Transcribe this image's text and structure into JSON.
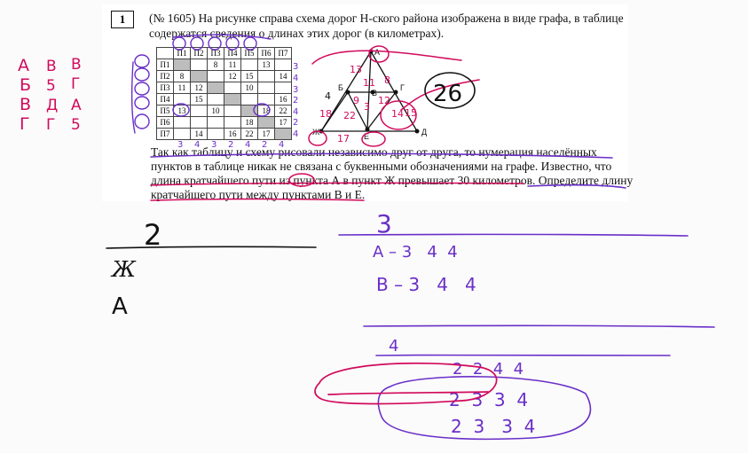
{
  "task": {
    "number": "1",
    "line1": "(№ 1605) На рисунке справа схема дорог Н-ского района изображена в виде графа, в таблице",
    "line2": "содержатся сведения о длинах этих дорог (в километрах).",
    "para1": "Так как таблицу и схему рисовали независимо друг от друга, то нумерация населённых",
    "para2": "пунктов в таблице никак не связана с буквенными обозначениями на графе. Известно, что",
    "para3": "длина кратчайшего пути из пункта А в пункт Ж превышает 30 километров. Определите длину",
    "para4": "кратчайшего пути между пунктами В и Е."
  },
  "table": {
    "headers": [
      "",
      "П1",
      "П2",
      "П3",
      "П4",
      "П5",
      "П6",
      "П7"
    ],
    "rows": [
      {
        "label": "П1",
        "cells": [
          "",
          "",
          "8",
          "11",
          "",
          "13",
          ""
        ]
      },
      {
        "label": "П2",
        "cells": [
          "8",
          "",
          "",
          "12",
          "15",
          "",
          "14"
        ]
      },
      {
        "label": "П3",
        "cells": [
          "11",
          "12",
          "",
          "",
          "10",
          "",
          ""
        ]
      },
      {
        "label": "П4",
        "cells": [
          "",
          "15",
          "",
          "",
          "",
          "",
          "16"
        ]
      },
      {
        "label": "П5",
        "cells": [
          "13",
          "",
          "10",
          "",
          "",
          "18",
          "22"
        ]
      },
      {
        "label": "П6",
        "cells": [
          "",
          "",
          "",
          "",
          "18",
          "",
          "17"
        ]
      },
      {
        "label": "П7",
        "cells": [
          "",
          "14",
          "",
          "16",
          "22",
          "17",
          ""
        ]
      }
    ]
  },
  "graph": {
    "nodes": [
      "А",
      "Б",
      "В",
      "Г",
      "Д",
      "Е",
      "Ж"
    ]
  },
  "annotations": {
    "letters_col1": [
      "А",
      "Б",
      "В",
      "Г"
    ],
    "letters_col2": [
      "Б",
      "5",
      "Д",
      "Г"
    ],
    "letters_col3": [
      "В",
      "Г",
      "А",
      "5"
    ],
    "row_degrees": [
      "3",
      "4",
      "3",
      "2",
      "4",
      "2",
      "4"
    ],
    "col_degrees": [
      "3",
      "4",
      "3",
      "2",
      "4",
      "2",
      "4"
    ],
    "graph_weights": [
      "13",
      "8",
      "11",
      "9",
      "12",
      "3",
      "14",
      "18",
      "22",
      "17",
      "15",
      "4"
    ],
    "graph_labels": [
      "А",
      "4",
      "4",
      "В",
      "Е",
      "2",
      "4"
    ],
    "circled_answer": "26",
    "left_numerator": "2",
    "left_den1": "Ж",
    "left_den2": "А",
    "right_top": "3",
    "right_rowA": "А – 3   4  4",
    "right_rowB": "В – 3   4   4",
    "right_mid": "4",
    "right_r1": "2  2  4  4",
    "right_r2": "2  3  3  4",
    "right_r3": "2  3   3  4"
  }
}
